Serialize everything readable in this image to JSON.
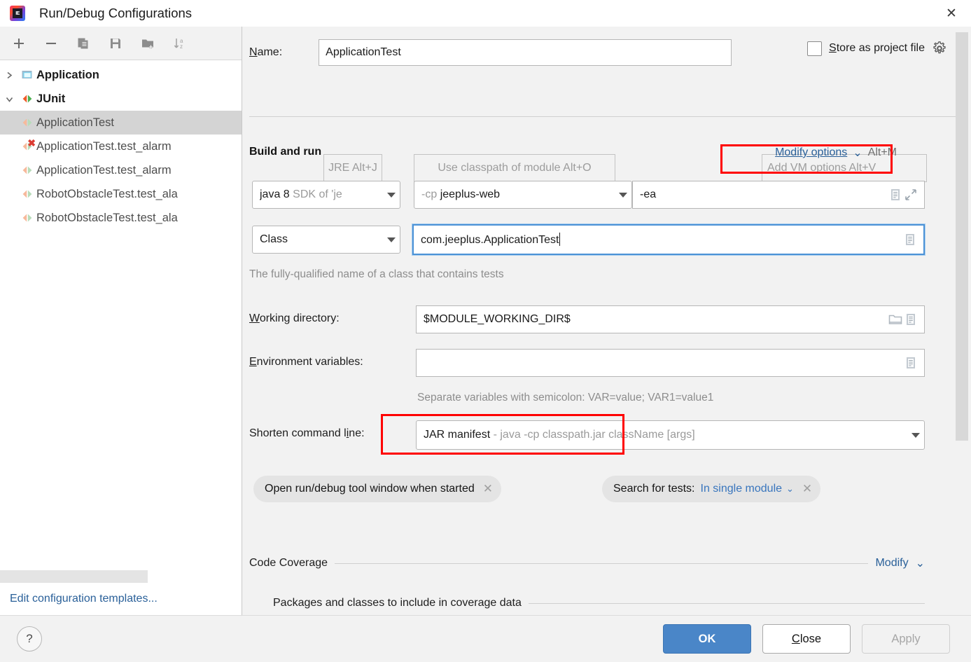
{
  "window": {
    "title": "Run/Debug Configurations",
    "logo_text": "IE",
    "close_icon": "close-icon"
  },
  "sidebar": {
    "toolbar": [
      {
        "name": "add-configuration-button",
        "icon": "plus-icon"
      },
      {
        "name": "remove-configuration-button",
        "icon": "minus-icon"
      },
      {
        "name": "copy-configuration-button",
        "icon": "copy-icon"
      },
      {
        "name": "save-configuration-button",
        "icon": "save-icon"
      },
      {
        "name": "new-folder-button",
        "icon": "new-folder-icon"
      },
      {
        "name": "sort-configurations-button",
        "icon": "sort-az-icon"
      }
    ],
    "tree": [
      {
        "label": "Application",
        "type": "group",
        "expanded": false,
        "icon": "application-icon"
      },
      {
        "label": "JUnit",
        "type": "group",
        "expanded": true,
        "icon": "junit-icon"
      },
      {
        "label": "ApplicationTest",
        "type": "item",
        "selected": true,
        "icon": "junit-run-icon",
        "error": false
      },
      {
        "label": "ApplicationTest.test_alarm",
        "type": "item",
        "selected": false,
        "icon": "junit-run-icon",
        "error": true
      },
      {
        "label": "ApplicationTest.test_alarm",
        "type": "item",
        "selected": false,
        "icon": "junit-run-icon",
        "error": false
      },
      {
        "label": "RobotObstacleTest.test_ala",
        "type": "item",
        "selected": false,
        "icon": "junit-run-icon",
        "error": false
      },
      {
        "label": "RobotObstacleTest.test_ala",
        "type": "item",
        "selected": false,
        "icon": "junit-run-icon",
        "error": false
      }
    ],
    "edit_templates_link": "Edit configuration templates..."
  },
  "form": {
    "name_label": "Name:",
    "name_value": "ApplicationTest",
    "store_as_project_file_label": "Store as project file",
    "store_as_project_file_checked": false,
    "gear_icon": "gear-icon",
    "build_and_run_title": "Build and run",
    "modify_options_link": "Modify options",
    "modify_options_shortcut": "Alt+M",
    "jre_hint": "JRE Alt+J",
    "jre_hint_key": "J",
    "classpath_hint": "Use classpath of module Alt+O",
    "classpath_hint_key": "O",
    "vm_options_hint": "Add VM options Alt+V",
    "vm_options_hint_key": "V",
    "jre_value_main": "java 8",
    "jre_value_dim": "SDK of 'je",
    "module_value_dim": "-cp",
    "module_value_main": "jeeplus-web",
    "vm_options_value": "-ea",
    "kind_value": "Class",
    "class_value": "com.jeeplus.ApplicationTest",
    "class_hint": "The fully-qualified name of a class that contains tests",
    "working_directory_label": "Working directory:",
    "working_directory_value": "$MODULE_WORKING_DIR$",
    "environment_variables_label": "Environment variables:",
    "environment_variables_value": "",
    "environment_variables_hint": "Separate variables with semicolon: VAR=value; VAR1=value1",
    "shorten_command_line_label": "Shorten command line:",
    "shorten_command_line_value_main": "JAR manifest",
    "shorten_command_line_value_dim": "- java -cp classpath.jar className [args]",
    "chip_open_tool_window": "Open run/debug tool window when started",
    "chip_search_for_tests_label": "Search for tests:",
    "chip_search_for_tests_value": "In single module",
    "code_coverage_title": "Code Coverage",
    "code_coverage_modify": "Modify",
    "coverage_packages_title": "Packages and classes to include in coverage data"
  },
  "footer": {
    "help_label": "?",
    "ok_label": "OK",
    "close_label": "Close",
    "apply_label": "Apply",
    "apply_disabled": true
  },
  "annotations": {
    "highlight_color": "#ff0000",
    "boxes": [
      "modify-options-highlight",
      "shorten-command-line-highlight"
    ]
  }
}
